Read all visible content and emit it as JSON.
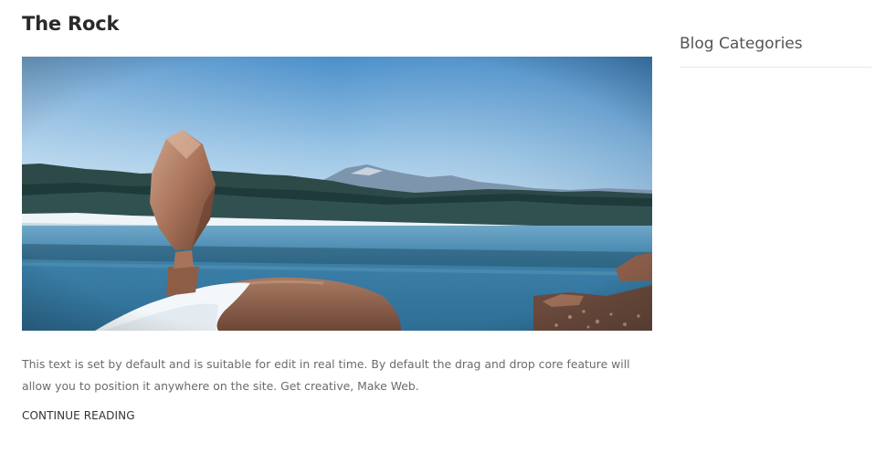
{
  "post": {
    "title": "The Rock",
    "image_alt": "Balanced rock stack beside a mountain lake",
    "excerpt": "This text is set by default and is suitable for edit in real time. By default the drag and drop core feature will allow you to position it anywhere on the site. Get creative, Make Web.",
    "read_more_label": "CONTINUE READING"
  },
  "sidebar": {
    "widget_title": "Blog Categories"
  },
  "colors": {
    "title": "#2a2a2a",
    "text": "#6b6b6b",
    "divider": "#e6e6e6",
    "sky": "#4f95cc",
    "water": "#3a7fa6"
  }
}
